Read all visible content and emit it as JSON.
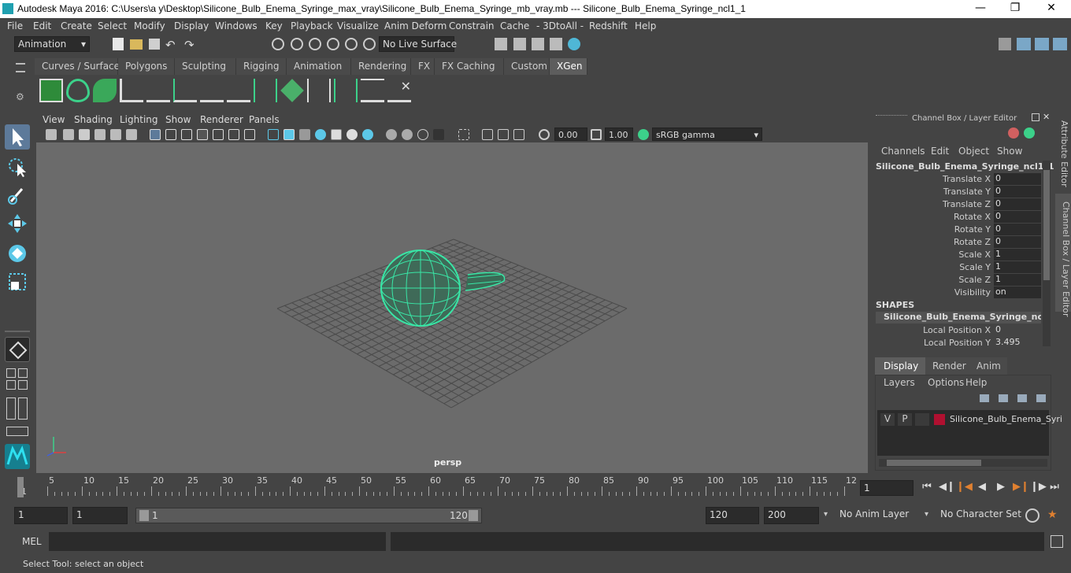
{
  "titlebar": {
    "title": "Autodesk Maya 2016: C:\\Users\\a y\\Desktop\\Silicone_Bulb_Enema_Syringe_max_vray\\Silicone_Bulb_Enema_Syringe_mb_vray.mb   ---   Silicone_Bulb_Enema_Syringe_ncl1_1",
    "minimize": "—",
    "maximize": "❐",
    "close": "✕"
  },
  "menubar": [
    "File",
    "Edit",
    "Create",
    "Select",
    "Modify",
    "Display",
    "Windows",
    "Key",
    "Playback",
    "Visualize",
    "Anim Deform",
    "Constrain",
    "Cache",
    "- 3DtoAll -",
    "Redshift",
    "Help"
  ],
  "toolrow": {
    "mode": "Animation",
    "live_surface": "No Live Surface"
  },
  "shelf_tabs": [
    "Curves / Surfaces",
    "Polygons",
    "Sculpting",
    "Rigging",
    "Animation",
    "Rendering",
    "FX",
    "FX Caching",
    "Custom",
    "XGen"
  ],
  "shelf_active": "XGen",
  "shelf_icons": [
    "xgen-create-icon",
    "xgen-preview-icon",
    "xgen-leaf-icon",
    "xgen-add-guides-icon",
    "xgen-place-icon",
    "xgen-guide-sculpt-icon",
    "xgen-guide-view-icon",
    "xgen-guide-lock-icon",
    "xgen-grass-icon",
    "xgen-groom-icon",
    "xgen-guide-edit-icon",
    "xgen-brush-icon",
    "xgen-cut-icon",
    "xgen-delete-icon"
  ],
  "viewport": {
    "menu": [
      "View",
      "Shading",
      "Lighting",
      "Show",
      "Renderer",
      "Panels"
    ],
    "exposure": "0.00",
    "gamma": "1.00",
    "colorspace": "sRGB gamma",
    "camera_label": "persp"
  },
  "channel_box": {
    "header": "Channel Box / Layer Editor",
    "menu": [
      "Channels",
      "Edit",
      "Object",
      "Show"
    ],
    "object": "Silicone_Bulb_Enema_Syringe_ncl1_1",
    "attributes": [
      {
        "label": "Translate X",
        "value": "0"
      },
      {
        "label": "Translate Y",
        "value": "0"
      },
      {
        "label": "Translate Z",
        "value": "0"
      },
      {
        "label": "Rotate X",
        "value": "0"
      },
      {
        "label": "Rotate Y",
        "value": "0"
      },
      {
        "label": "Rotate Z",
        "value": "0"
      },
      {
        "label": "Scale X",
        "value": "1"
      },
      {
        "label": "Scale Y",
        "value": "1"
      },
      {
        "label": "Scale Z",
        "value": "1"
      },
      {
        "label": "Visibility",
        "value": "on"
      }
    ],
    "shapes_title": "SHAPES",
    "shape_name": "Silicone_Bulb_Enema_Syringe_ncl1_...",
    "shape_attrs": [
      {
        "label": "Local Position X",
        "value": "0"
      },
      {
        "label": "Local Position Y",
        "value": "3.495"
      }
    ],
    "side_tabs": [
      "Attribute Editor",
      "Channel Box / Layer Editor"
    ]
  },
  "layer_editor": {
    "tabs": [
      "Display",
      "Render",
      "Anim"
    ],
    "active_tab": "Display",
    "menu": [
      "Layers",
      "Options",
      "Help"
    ],
    "layer": {
      "v": "V",
      "p": "P",
      "name": "Silicone_Bulb_Enema_Syri",
      "color": "#b01030"
    }
  },
  "timeline": {
    "ticks": [
      "1",
      "5",
      "10",
      "15",
      "20",
      "25",
      "30",
      "35",
      "40",
      "45",
      "50",
      "55",
      "60",
      "65",
      "70",
      "75",
      "80",
      "85",
      "90",
      "95",
      "100",
      "105",
      "110",
      "115",
      "12"
    ],
    "current_frame": "1"
  },
  "range": {
    "start": "1",
    "playback_start": "1",
    "slider_start": "1",
    "slider_end": "120",
    "playback_end": "120",
    "end": "200",
    "anim_layer": "No Anim Layer",
    "character_set": "No Character Set"
  },
  "cmdline": {
    "label": "MEL"
  },
  "status": {
    "help": "Select Tool: select an object"
  },
  "colors": {
    "accent": "#5ce0a0",
    "wire": "#39e6a6",
    "layer_color": "#b01030"
  }
}
